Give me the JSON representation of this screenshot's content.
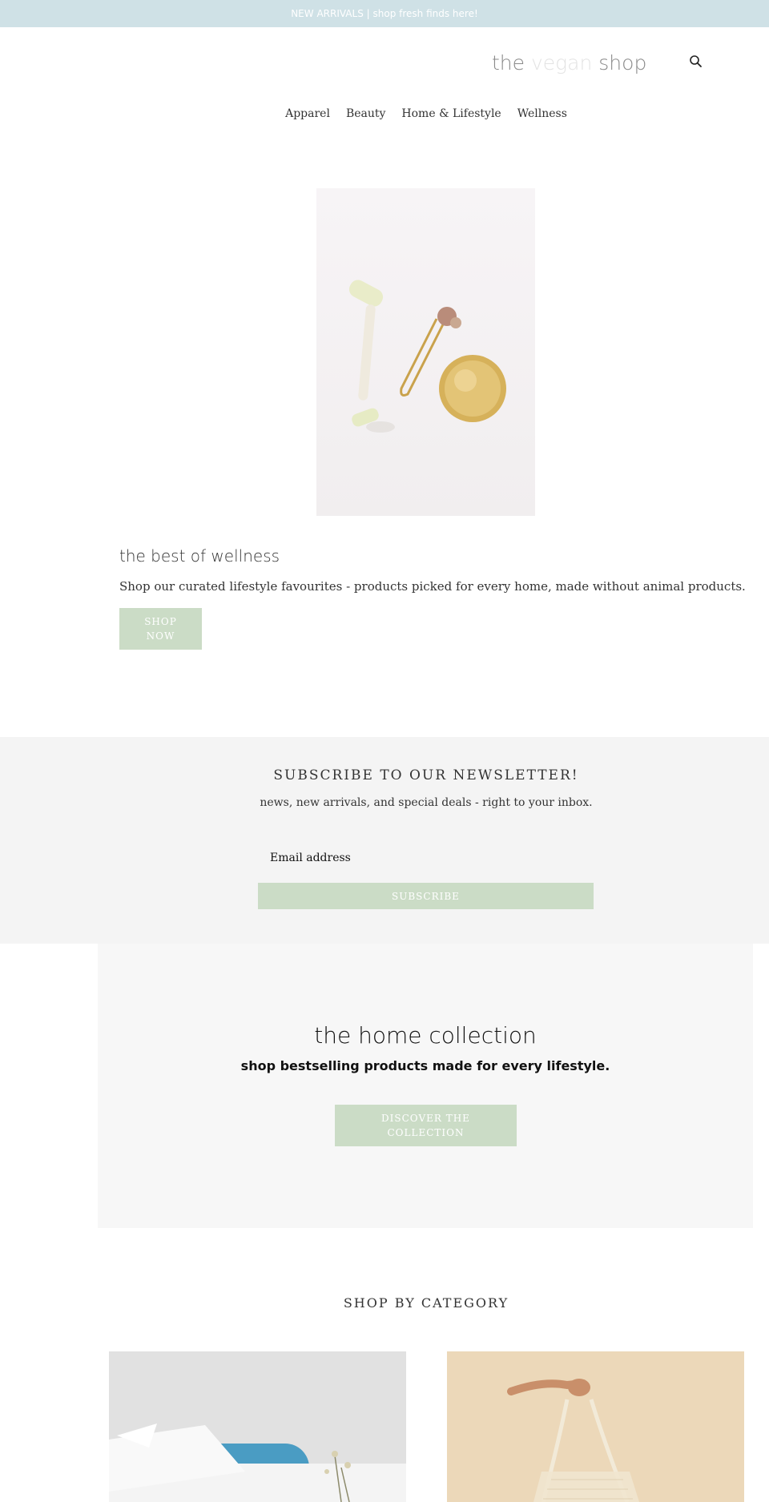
{
  "announcement": "NEW ARRIVALS | shop fresh finds here!",
  "logo": {
    "part1": "the ",
    "accent": "vegan",
    "part3": " shop"
  },
  "nav": [
    "Apparel",
    "Beauty",
    "Home & Lifestyle",
    "Wellness"
  ],
  "hero": {
    "title": "the best of wellness",
    "subtitle": "Shop our curated lifestyle favourites - products picked for every home, made without animal products.",
    "button": "SHOP NOW"
  },
  "newsletter": {
    "title": "SUBSCRIBE TO OUR NEWSLETTER!",
    "subtitle": "news, new arrivals, and special deals - right to your inbox.",
    "placeholder": "Email address",
    "button": "SUBSCRIBE"
  },
  "collection": {
    "title": "the home collection",
    "subtitle": "shop bestselling products made for every lifestyle.",
    "button": "DISCOVER THE COLLECTION"
  },
  "categories": {
    "title": "SHOP BY CATEGORY"
  },
  "colors": {
    "announcement_bg": "#cfe1e6",
    "button_green": "#cbdcc6",
    "newsletter_bg": "#f4f4f4",
    "collection_bg": "#f7f7f7"
  },
  "icons": [
    "search-icon"
  ]
}
